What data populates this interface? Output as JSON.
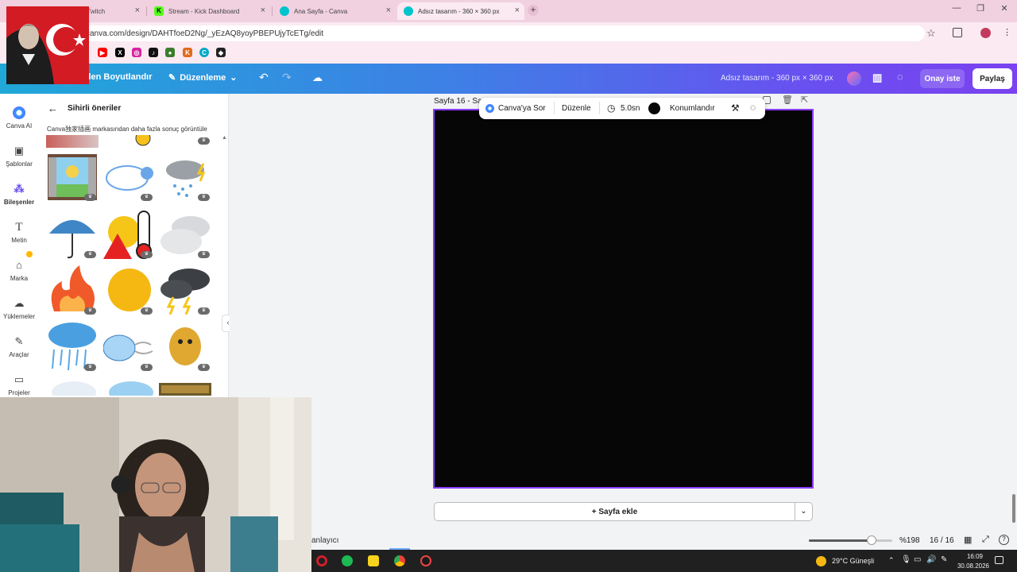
{
  "browser": {
    "tabs": [
      {
        "label": "Duduk_Kremi - Twitch",
        "color": "#9146ff"
      },
      {
        "label": "Stream - Kick Dashboard",
        "color": "#53fc18"
      },
      {
        "label": "Ana Sayfa - Canva",
        "color": "#00c4cc"
      },
      {
        "label": "Adsız tasarım - 360 × 360 px",
        "color": "#00c4cc"
      }
    ],
    "url": "canva.com/design/DAHTfoeD2Ng/_yEzAQ8yoyPBEPUjyTcETg/edit"
  },
  "header": {
    "resize": "niden Boyutlandır",
    "edit": "Düzenleme",
    "design_title": "Adsız tasarım - 360 px × 360 px",
    "approve": "Onay iste",
    "share": "Paylaş"
  },
  "rail": [
    {
      "label": "Canva AI",
      "icon": "canva-ai-icon"
    },
    {
      "label": "Şablonlar",
      "icon": "templates-icon"
    },
    {
      "label": "Bileşenler",
      "icon": "elements-icon"
    },
    {
      "label": "Metin",
      "icon": "text-icon"
    },
    {
      "label": "Marka",
      "icon": "brand-icon"
    },
    {
      "label": "Yüklemeler",
      "icon": "uploads-icon"
    },
    {
      "label": "Araçlar",
      "icon": "tools-icon"
    },
    {
      "label": "Projeler",
      "icon": "projects-icon"
    }
  ],
  "panel": {
    "title": "Sihirli öneriler",
    "note": "Canva独家插画 markasından daha fazla sonuç görüntüle"
  },
  "canvas": {
    "page_label": "Sayfa 16 - Sa",
    "ask": "Canva'ya Sor",
    "edit": "Düzenle",
    "duration": "5.0sn",
    "position": "Konumlandır",
    "add_page": "+ Sayfa ekle",
    "page_color": "#060606"
  },
  "footer": {
    "notes": "anlayıcı",
    "zoom": "%198",
    "zoom_fraction": 0.75,
    "pages": "16 / 16"
  },
  "taskbar": {
    "weather": "29°C  Güneşli",
    "time": "16:09",
    "date": "30.08.2026"
  }
}
